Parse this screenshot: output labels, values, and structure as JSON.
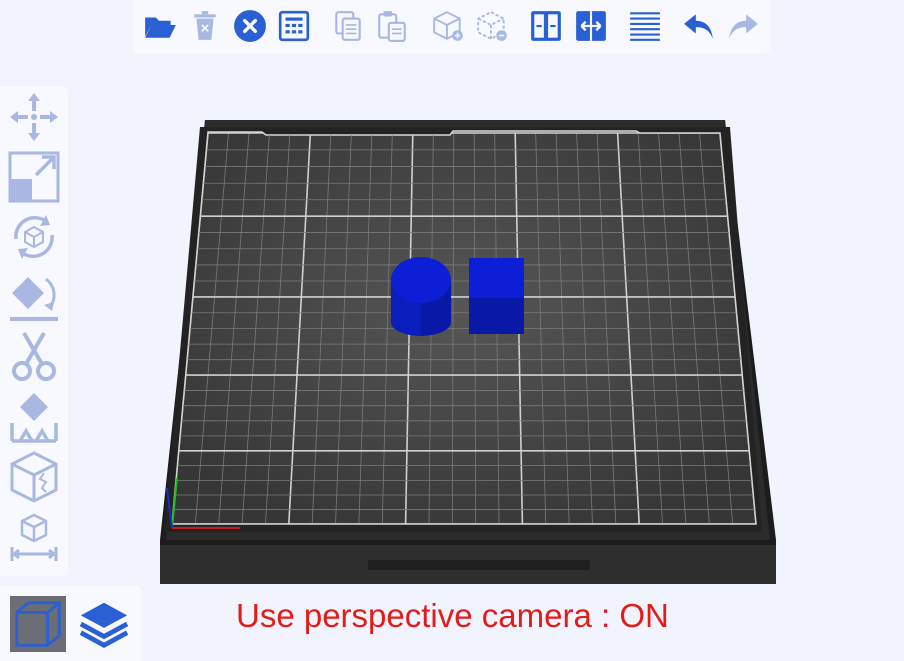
{
  "top_toolbar": {
    "buttons": [
      {
        "name": "open-file",
        "icon": "folder-open-icon",
        "enabled": true
      },
      {
        "name": "delete",
        "icon": "trash-icon",
        "enabled": false
      },
      {
        "name": "delete-all",
        "icon": "close-circle-icon",
        "enabled": true
      },
      {
        "name": "arrange",
        "icon": "grid-arrange-icon",
        "enabled": true
      },
      {
        "name": "copy",
        "icon": "copy-icon",
        "enabled": false
      },
      {
        "name": "paste",
        "icon": "paste-icon",
        "enabled": false
      },
      {
        "name": "add-instance",
        "icon": "cube-plus-icon",
        "enabled": false
      },
      {
        "name": "remove-instance",
        "icon": "cube-minus-icon",
        "enabled": false
      },
      {
        "name": "split-to-objects",
        "icon": "split-objects-icon",
        "enabled": true
      },
      {
        "name": "split-to-parts",
        "icon": "split-parts-icon",
        "enabled": true
      },
      {
        "name": "layers-editing",
        "icon": "layers-editing-icon",
        "enabled": true
      },
      {
        "name": "undo",
        "icon": "undo-icon",
        "enabled": true
      },
      {
        "name": "redo",
        "icon": "redo-icon",
        "enabled": false
      }
    ]
  },
  "left_toolbar": {
    "tools": [
      {
        "name": "move",
        "icon": "move-icon"
      },
      {
        "name": "scale",
        "icon": "scale-icon"
      },
      {
        "name": "rotate",
        "icon": "rotate-icon"
      },
      {
        "name": "place-on-face",
        "icon": "place-on-face-icon"
      },
      {
        "name": "cut",
        "icon": "cut-icon"
      },
      {
        "name": "supports",
        "icon": "supports-icon"
      },
      {
        "name": "seam",
        "icon": "seam-icon"
      },
      {
        "name": "measure",
        "icon": "measure-icon"
      }
    ]
  },
  "view_panel": {
    "buttons": [
      {
        "name": "3d-view",
        "icon": "cube-view-icon",
        "active": true
      },
      {
        "name": "preview",
        "icon": "layers-icon",
        "active": false
      }
    ]
  },
  "status": {
    "message": "Use perspective camera : ON",
    "color": "#e31b1b"
  },
  "colors": {
    "toolbar_icon": "#2a60d4",
    "toolbar_icon_disabled": "#a8b8e2",
    "bed_surface": "#474747",
    "bed_frame": "#2b2b2b",
    "model": "#0a1acc"
  }
}
